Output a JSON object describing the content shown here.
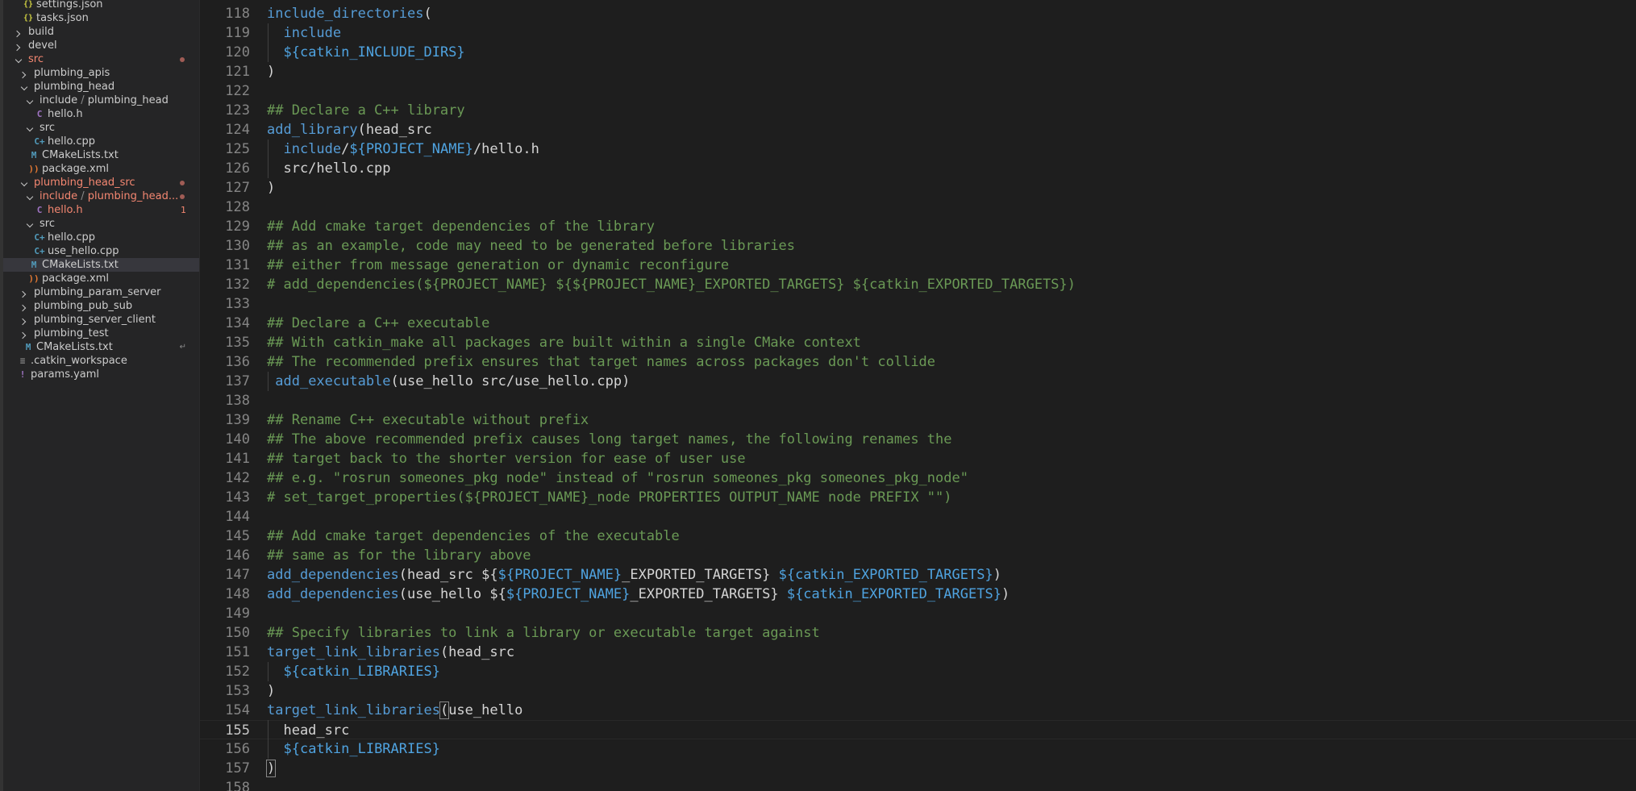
{
  "explorer": {
    "items": [
      {
        "label": "settings.json",
        "icon": "json-file-icon",
        "iconGlyph": "{}",
        "iconClass": "json",
        "depth": 1,
        "chevron": "none"
      },
      {
        "label": "tasks.json",
        "icon": "json-file-icon",
        "iconGlyph": "{}",
        "iconClass": "json",
        "depth": 1,
        "chevron": "none"
      },
      {
        "label": "build",
        "icon": "",
        "iconGlyph": "",
        "iconClass": "",
        "depth": 0,
        "chevron": "right"
      },
      {
        "label": "devel",
        "icon": "",
        "iconGlyph": "",
        "iconClass": "",
        "depth": 0,
        "chevron": "right"
      },
      {
        "label": "src",
        "icon": "",
        "iconGlyph": "",
        "iconClass": "",
        "depth": 0,
        "chevron": "down",
        "error": true,
        "dot": true
      },
      {
        "label": "plumbing_apis",
        "icon": "",
        "iconGlyph": "",
        "iconClass": "",
        "depth": 1,
        "chevron": "right"
      },
      {
        "label": "plumbing_head",
        "icon": "",
        "iconGlyph": "",
        "iconClass": "",
        "depth": 1,
        "chevron": "down"
      },
      {
        "label": "include",
        "label2": "plumbing_head",
        "icon": "",
        "iconGlyph": "",
        "iconClass": "",
        "depth": 2,
        "chevron": "down"
      },
      {
        "label": "hello.h",
        "icon": "c-header-file-icon",
        "iconGlyph": "C",
        "iconClass": "c",
        "depth": 3,
        "chevron": "none"
      },
      {
        "label": "src",
        "icon": "",
        "iconGlyph": "",
        "iconClass": "",
        "depth": 2,
        "chevron": "down"
      },
      {
        "label": "hello.cpp",
        "icon": "cpp-file-icon",
        "iconGlyph": "C+",
        "iconClass": "cpp",
        "depth": 3,
        "chevron": "none"
      },
      {
        "label": "CMakeLists.txt",
        "icon": "cmake-file-icon",
        "iconGlyph": "M",
        "iconClass": "cmake",
        "depth": 2,
        "chevron": "none"
      },
      {
        "label": "package.xml",
        "icon": "xml-file-icon",
        "iconGlyph": "))",
        "iconClass": "xml",
        "depth": 2,
        "chevron": "none"
      },
      {
        "label": "plumbing_head_src",
        "icon": "",
        "iconGlyph": "",
        "iconClass": "",
        "depth": 1,
        "chevron": "down",
        "error": true,
        "dot": true
      },
      {
        "label": "include",
        "label2": "plumbing_head...",
        "icon": "",
        "iconGlyph": "",
        "iconClass": "",
        "depth": 2,
        "chevron": "down",
        "error": true,
        "dot": true
      },
      {
        "label": "hello.h",
        "icon": "c-header-file-icon",
        "iconGlyph": "C",
        "iconClass": "c",
        "depth": 3,
        "chevron": "none",
        "error": true,
        "badge": "1"
      },
      {
        "label": "src",
        "icon": "",
        "iconGlyph": "",
        "iconClass": "",
        "depth": 2,
        "chevron": "down"
      },
      {
        "label": "hello.cpp",
        "icon": "cpp-file-icon",
        "iconGlyph": "C+",
        "iconClass": "cpp",
        "depth": 3,
        "chevron": "none"
      },
      {
        "label": "use_hello.cpp",
        "icon": "cpp-file-icon",
        "iconGlyph": "C+",
        "iconClass": "cpp",
        "depth": 3,
        "chevron": "none"
      },
      {
        "label": "CMakeLists.txt",
        "icon": "cmake-file-icon",
        "iconGlyph": "M",
        "iconClass": "cmake",
        "depth": 2,
        "chevron": "none",
        "selected": true
      },
      {
        "label": "package.xml",
        "icon": "xml-file-icon",
        "iconGlyph": "))",
        "iconClass": "xml",
        "depth": 2,
        "chevron": "none"
      },
      {
        "label": "plumbing_param_server",
        "icon": "",
        "iconGlyph": "",
        "iconClass": "",
        "depth": 1,
        "chevron": "right"
      },
      {
        "label": "plumbing_pub_sub",
        "icon": "",
        "iconGlyph": "",
        "iconClass": "",
        "depth": 1,
        "chevron": "right"
      },
      {
        "label": "plumbing_server_client",
        "icon": "",
        "iconGlyph": "",
        "iconClass": "",
        "depth": 1,
        "chevron": "right"
      },
      {
        "label": "plumbing_test",
        "icon": "",
        "iconGlyph": "",
        "iconClass": "",
        "depth": 1,
        "chevron": "right"
      },
      {
        "label": "CMakeLists.txt",
        "icon": "cmake-file-icon",
        "iconGlyph": "M",
        "iconClass": "cmake",
        "depth": 1,
        "chevron": "none",
        "arrow": "↵"
      },
      {
        "label": ".catkin_workspace",
        "icon": "workspace-file-icon",
        "iconGlyph": "≡",
        "iconClass": "ws",
        "depth": 0,
        "chevron": "none"
      },
      {
        "label": "params.yaml",
        "icon": "yaml-file-icon",
        "iconGlyph": "!",
        "iconClass": "yaml",
        "depth": 0,
        "chevron": "none"
      }
    ]
  },
  "editor": {
    "currentLine": 155,
    "lines": [
      {
        "n": "118",
        "tokens": [
          [
            "fn",
            "include_directories"
          ],
          [
            "tx",
            "("
          ]
        ]
      },
      {
        "n": "119",
        "tokens": [
          [
            "tx",
            "  "
          ],
          [
            "fn",
            "include"
          ]
        ]
      },
      {
        "n": "120",
        "tokens": [
          [
            "tx",
            "  "
          ],
          [
            "var",
            "${catkin_INCLUDE_DIRS}"
          ]
        ]
      },
      {
        "n": "121",
        "tokens": [
          [
            "tx",
            ")"
          ]
        ]
      },
      {
        "n": "122",
        "tokens": []
      },
      {
        "n": "123",
        "tokens": [
          [
            "cm",
            "## Declare a C++ library"
          ]
        ]
      },
      {
        "n": "124",
        "tokens": [
          [
            "fn",
            "add_library"
          ],
          [
            "tx",
            "(head_src"
          ]
        ]
      },
      {
        "n": "125",
        "tokens": [
          [
            "tx",
            "  "
          ],
          [
            "fn",
            "include"
          ],
          [
            "tx",
            "/"
          ],
          [
            "var",
            "${PROJECT_NAME}"
          ],
          [
            "tx",
            "/hello.h"
          ]
        ]
      },
      {
        "n": "126",
        "tokens": [
          [
            "tx",
            "  src/hello.cpp"
          ]
        ]
      },
      {
        "n": "127",
        "tokens": [
          [
            "tx",
            ")"
          ]
        ]
      },
      {
        "n": "128",
        "tokens": []
      },
      {
        "n": "129",
        "tokens": [
          [
            "cm",
            "## Add cmake target dependencies of the library"
          ]
        ]
      },
      {
        "n": "130",
        "tokens": [
          [
            "cm",
            "## as an example, code may need to be generated before libraries"
          ]
        ]
      },
      {
        "n": "131",
        "tokens": [
          [
            "cm",
            "## either from message generation or dynamic reconfigure"
          ]
        ]
      },
      {
        "n": "132",
        "tokens": [
          [
            "cm",
            "# add_dependencies(${PROJECT_NAME} ${${PROJECT_NAME}_EXPORTED_TARGETS} ${catkin_EXPORTED_TARGETS})"
          ]
        ]
      },
      {
        "n": "133",
        "tokens": []
      },
      {
        "n": "134",
        "tokens": [
          [
            "cm",
            "## Declare a C++ executable"
          ]
        ]
      },
      {
        "n": "135",
        "tokens": [
          [
            "cm",
            "## With catkin_make all packages are built within a single CMake context"
          ]
        ]
      },
      {
        "n": "136",
        "tokens": [
          [
            "cm",
            "## The recommended prefix ensures that target names across packages don't collide"
          ]
        ]
      },
      {
        "n": "137",
        "tokens": [
          [
            "tx",
            " "
          ],
          [
            "fn",
            "add_executable"
          ],
          [
            "tx",
            "(use_hello src/use_hello.cpp)"
          ]
        ]
      },
      {
        "n": "138",
        "tokens": []
      },
      {
        "n": "139",
        "tokens": [
          [
            "cm",
            "## Rename C++ executable without prefix"
          ]
        ]
      },
      {
        "n": "140",
        "tokens": [
          [
            "cm",
            "## The above recommended prefix causes long target names, the following renames the"
          ]
        ]
      },
      {
        "n": "141",
        "tokens": [
          [
            "cm",
            "## target back to the shorter version for ease of user use"
          ]
        ]
      },
      {
        "n": "142",
        "tokens": [
          [
            "cm",
            "## e.g. \"rosrun someones_pkg node\" instead of \"rosrun someones_pkg someones_pkg_node\""
          ]
        ]
      },
      {
        "n": "143",
        "tokens": [
          [
            "cm",
            "# set_target_properties(${PROJECT_NAME}_node PROPERTIES OUTPUT_NAME node PREFIX \"\")"
          ]
        ]
      },
      {
        "n": "144",
        "tokens": []
      },
      {
        "n": "145",
        "tokens": [
          [
            "cm",
            "## Add cmake target dependencies of the executable"
          ]
        ]
      },
      {
        "n": "146",
        "tokens": [
          [
            "cm",
            "## same as for the library above"
          ]
        ]
      },
      {
        "n": "147",
        "tokens": [
          [
            "fn",
            "add_dependencies"
          ],
          [
            "tx",
            "(head_src ${"
          ],
          [
            "var",
            "${PROJECT_NAME}"
          ],
          [
            "tx",
            "_EXPORTED_TARGETS} "
          ],
          [
            "var",
            "${catkin_EXPORTED_TARGETS}"
          ],
          [
            "tx",
            ")"
          ]
        ]
      },
      {
        "n": "148",
        "tokens": [
          [
            "fn",
            "add_dependencies"
          ],
          [
            "tx",
            "(use_hello ${"
          ],
          [
            "var",
            "${PROJECT_NAME}"
          ],
          [
            "tx",
            "_EXPORTED_TARGETS} "
          ],
          [
            "var",
            "${catkin_EXPORTED_TARGETS}"
          ],
          [
            "tx",
            ")"
          ]
        ]
      },
      {
        "n": "149",
        "tokens": []
      },
      {
        "n": "150",
        "tokens": [
          [
            "cm",
            "## Specify libraries to link a library or executable target against"
          ]
        ]
      },
      {
        "n": "151",
        "tokens": [
          [
            "fn",
            "target_link_libraries"
          ],
          [
            "tx",
            "(head_src"
          ]
        ]
      },
      {
        "n": "152",
        "tokens": [
          [
            "tx",
            "  "
          ],
          [
            "var",
            "${catkin_LIBRARIES}"
          ]
        ]
      },
      {
        "n": "153",
        "tokens": [
          [
            "tx",
            ")"
          ]
        ]
      },
      {
        "n": "154",
        "tokens": [
          [
            "fn",
            "target_link_libraries"
          ],
          [
            "br",
            "("
          ],
          [
            "tx",
            "use_hello"
          ]
        ]
      },
      {
        "n": "155",
        "tokens": [
          [
            "tx",
            "  head_src"
          ]
        ]
      },
      {
        "n": "156",
        "tokens": [
          [
            "tx",
            "  "
          ],
          [
            "var",
            "${catkin_LIBRARIES}"
          ]
        ]
      },
      {
        "n": "157",
        "tokens": [
          [
            "br",
            ")"
          ]
        ]
      },
      {
        "n": "158",
        "tokens": []
      }
    ]
  }
}
